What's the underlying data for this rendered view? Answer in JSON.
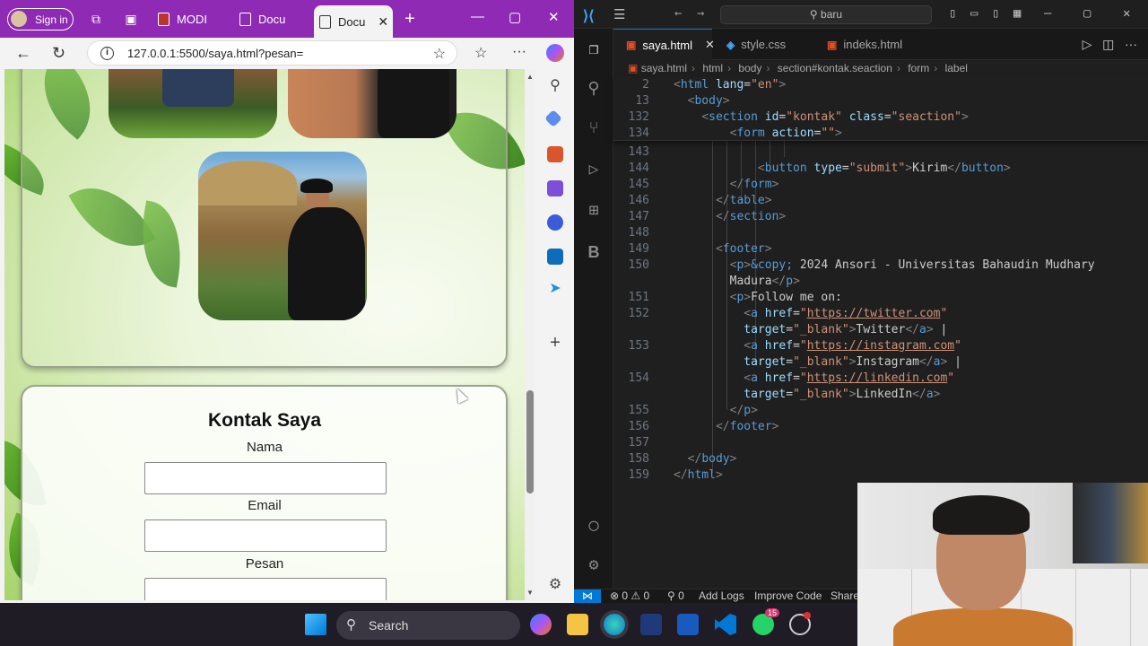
{
  "browser": {
    "signin": "Sign in",
    "tabs": [
      {
        "label": "MODI"
      },
      {
        "label": "Docu"
      },
      {
        "label": "Docu"
      }
    ],
    "url": "127.0.0.1:5500/saya.html?pesan=",
    "accent": "#8e2ab3"
  },
  "page": {
    "contact_title": "Kontak Saya",
    "labels": {
      "name": "Nama",
      "email": "Email",
      "message": "Pesan"
    }
  },
  "vscode": {
    "search": "baru",
    "tabs": [
      {
        "label": "saya.html"
      },
      {
        "label": "style.css"
      },
      {
        "label": "indeks.html"
      }
    ],
    "breadcrumb": [
      "saya.html",
      "html",
      "body",
      "section#kontak.seaction",
      "form",
      "label"
    ],
    "line_numbers": [
      "2",
      "13",
      "132",
      "134",
      "143",
      "144",
      "145",
      "146",
      "147",
      "148",
      "149",
      "150",
      "",
      "151",
      "152",
      "",
      "153",
      "",
      "154",
      "",
      "155",
      "156",
      "157",
      "158",
      "159"
    ],
    "status": {
      "errors": "0",
      "warnings": "0",
      "ports": "0",
      "add_logs": "Add Logs",
      "improve": "Improve Code",
      "share": "Share"
    }
  },
  "taskbar": {
    "search": "Search",
    "whatsapp_badge": "15"
  }
}
